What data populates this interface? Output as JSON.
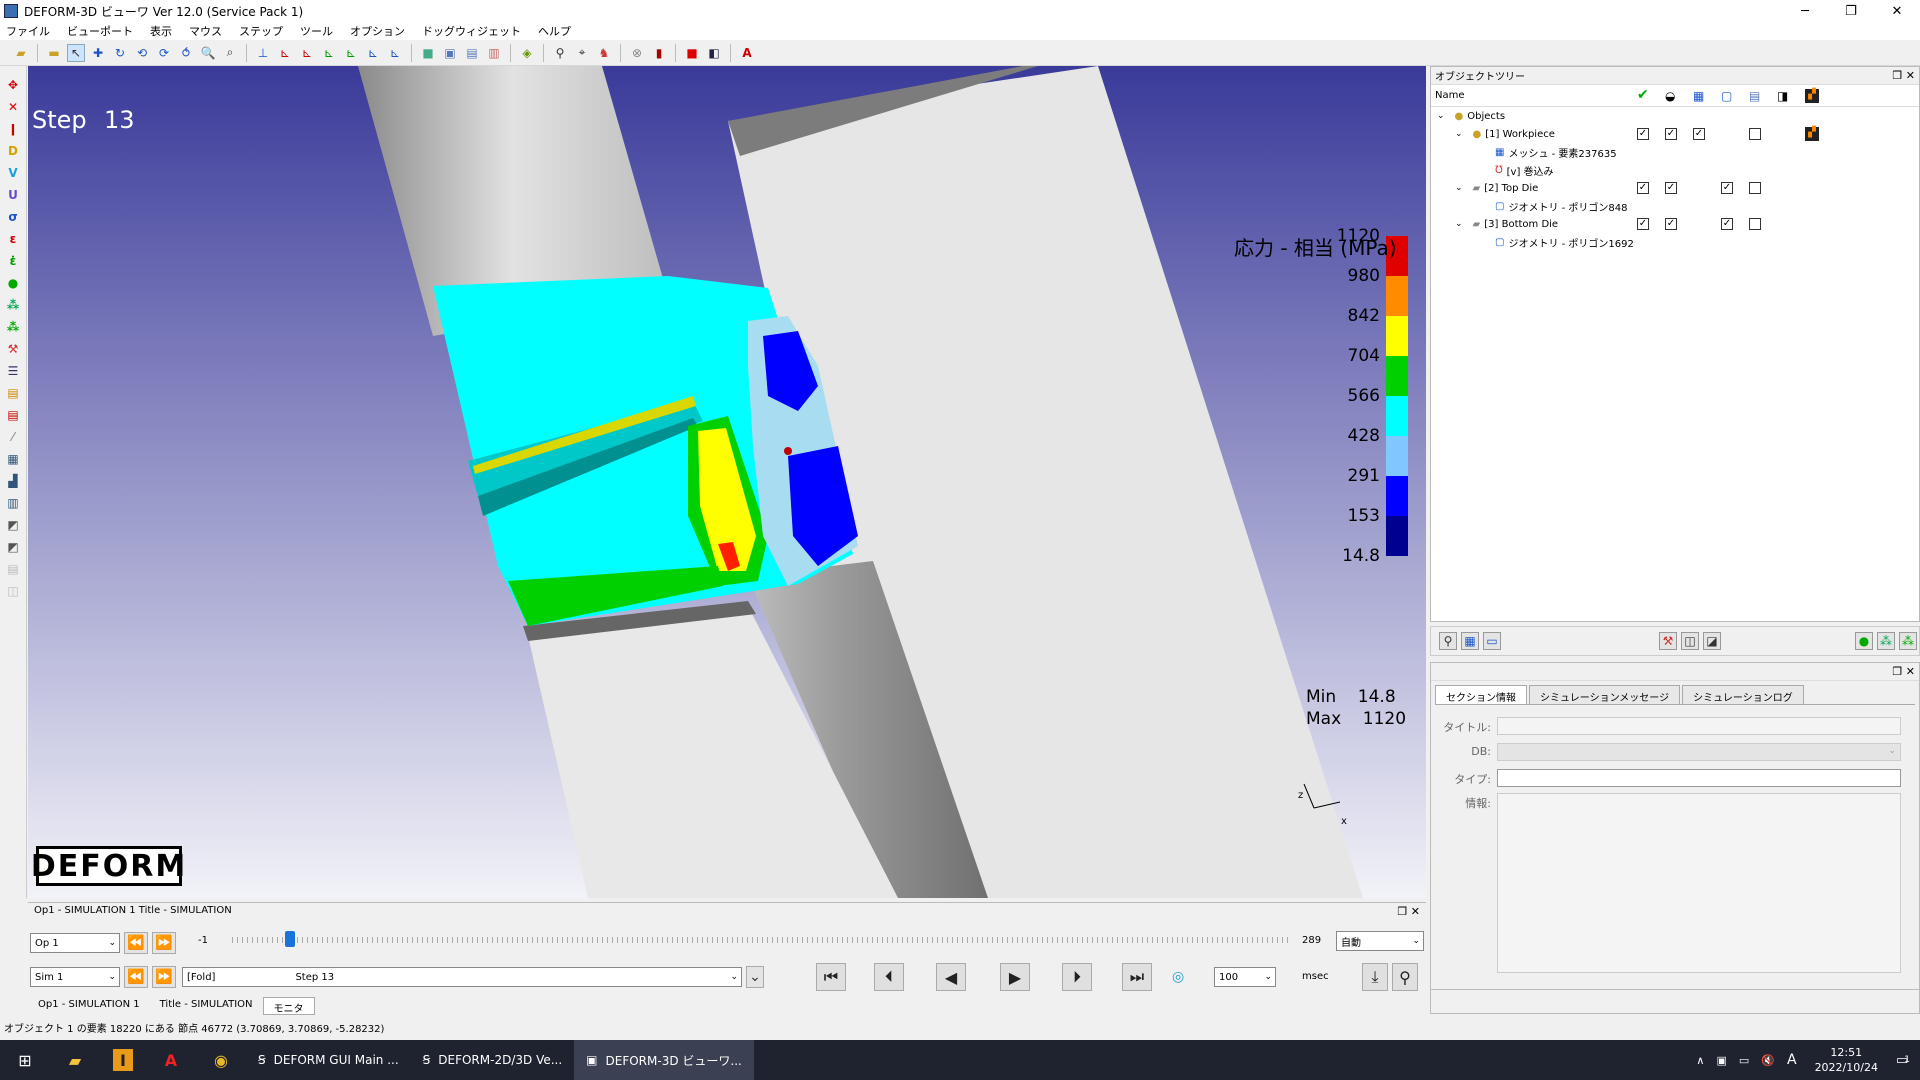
{
  "window": {
    "title": "DEFORM-3D ビューワ Ver 12.0 (Service Pack 1)",
    "min": "─",
    "max": "❐",
    "close": "✕"
  },
  "menu": [
    "ファイル",
    "ビューポート",
    "表示",
    "マウス",
    "ステップ",
    "ツール",
    "オプション",
    "ドッグウィジェット",
    "ヘルプ"
  ],
  "viewport": {
    "step_label": "Step",
    "step_number": "13",
    "legend": {
      "title": "応力 - 相当 (MPa)",
      "ticks": [
        "1120",
        "980",
        "842",
        "704",
        "566",
        "428",
        "291",
        "153",
        "14.8"
      ],
      "colors": [
        "#e00000",
        "#ff8c00",
        "#ffff00",
        "#00d000",
        "#00ffff",
        "#80c8ff",
        "#0000ff",
        "#000090"
      ],
      "min_label": "Min",
      "min_value": "14.8",
      "max_label": "Max",
      "max_value": "1120"
    },
    "logo": "DEFORM",
    "axes": {
      "z": "z",
      "x": "x"
    }
  },
  "object_tree": {
    "panel_title": "オブジェクトツリー",
    "name_header": "Name",
    "rows": [
      {
        "label": "Objects",
        "level": 0
      },
      {
        "label": "[1] Workpiece",
        "level": 1
      },
      {
        "label": "メッシュ - 要素237635",
        "level": 2
      },
      {
        "label": "[v] 巻込み",
        "level": 2
      },
      {
        "label": "[2] Top Die",
        "level": 1
      },
      {
        "label": "ジオメトリ - ポリゴン848",
        "level": 2
      },
      {
        "label": "[3] Bottom Die",
        "level": 1
      },
      {
        "label": "ジオメトリ - ポリゴン1692",
        "level": 2
      }
    ]
  },
  "info_panel": {
    "tabs": [
      "セクション情報",
      "シミュレーションメッセージ",
      "シミュレーションログ"
    ],
    "title_label": "タイトル:",
    "db_label": "DB:",
    "type_label": "タイプ:",
    "info_label": "情報:"
  },
  "animation": {
    "header": "Op1 - SIMULATION 1    Title - SIMULATION",
    "op_select": "Op 1",
    "sim_select": "Sim 1",
    "start_step": "-1",
    "end_step": "289",
    "mode": "自動",
    "step_combo_prefix": "[Fold]",
    "step_combo_value": "Step  13",
    "speed": "100",
    "unit": "msec",
    "slider_fraction": 0.05,
    "tabs": [
      "Op1 - SIMULATION 1",
      "Title - SIMULATION",
      "モニタ"
    ]
  },
  "status": "オブジェクト 1 の要素 18220 にある 節点 46772 (3.70869, 3.70869, -5.28232)",
  "taskbar": {
    "tasks": [
      "DEFORM GUI Main ...",
      "DEFORM-2D/3D Ve...",
      "DEFORM-3D ビューワ..."
    ],
    "ime": "A",
    "time": "12:51",
    "date": "2022/10/24",
    "notif": "1"
  }
}
